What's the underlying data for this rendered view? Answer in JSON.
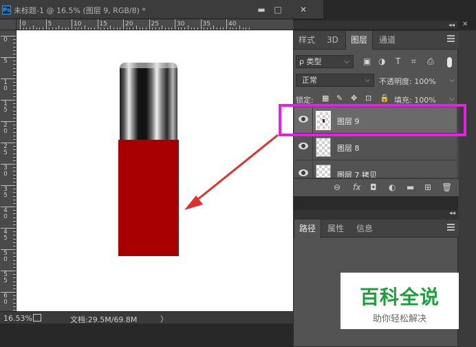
{
  "document": {
    "app_logo": "Ps",
    "title": "未标题-1 @ 16.5% (图层 9, RGB/8) *",
    "window_buttons": {
      "minimize": "▬",
      "maximize": "□",
      "close": "✕"
    },
    "ruler_top_labels": [
      "0",
      "5",
      "10",
      "15",
      "20",
      "25",
      "30",
      "35",
      "40"
    ],
    "ruler_left_labels": [
      "0",
      "5",
      "1 0",
      "1 5",
      "2 0",
      "2 5",
      "3 0",
      "3 5",
      "4 0",
      "4 5",
      "5 0",
      "5 5",
      "6 0"
    ],
    "status": {
      "zoom": "16.53%",
      "doc_size": "文档:29.5M/69.8M",
      "arrow": "〉"
    }
  },
  "canvas": {
    "cap_color": "#1a1a1a",
    "body_color": "#a80000"
  },
  "panel_controls": {
    "collapse": "◂◂",
    "close": "✕"
  },
  "layers_panel": {
    "tabs": [
      "样式",
      "3D",
      "图层",
      "通道"
    ],
    "active_tab": "图层",
    "filter": {
      "label": "ρ 类型",
      "caret": "⌵"
    },
    "filter_icons": [
      "▣",
      "◑",
      "T",
      "⌗",
      "⎙"
    ],
    "blend_mode": "正常",
    "opacity_label": "不透明度: 100%",
    "lock_label": "锁定:",
    "lock_icons": [
      "▦",
      "✎",
      "✥",
      "⊡",
      "🔒"
    ],
    "fill_label": "填充: 100%",
    "layers": [
      {
        "name": "图层 9",
        "selected": true
      },
      {
        "name": "图层 8",
        "selected": false
      },
      {
        "name": "图层 7 拷贝",
        "selected": false
      }
    ],
    "footer_icons": [
      "⊖",
      "fx",
      "◘",
      "◐",
      "▬",
      "⊞",
      "🗑"
    ],
    "highlight_color": "#e61ee6"
  },
  "paths_panel": {
    "tabs": [
      "路径",
      "属性",
      "信息"
    ],
    "active_tab": "路径"
  },
  "watermark": {
    "main": "百科全说",
    "sub": "助你轻松解决"
  },
  "annotation_arrow_color": "#e03030"
}
